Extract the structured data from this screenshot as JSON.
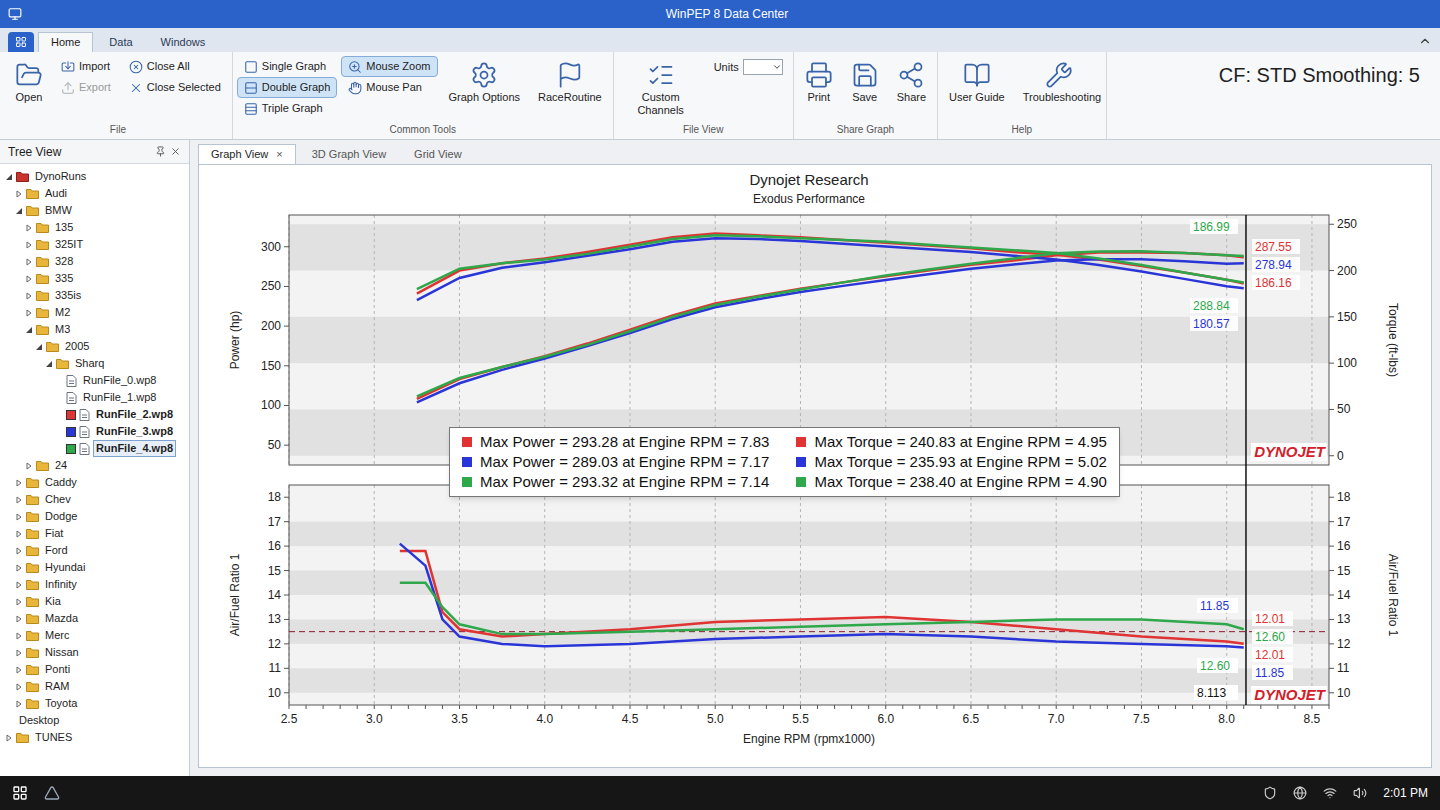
{
  "window": {
    "title": "WinPEP 8 Data Center"
  },
  "ribbon": {
    "tabs": [
      {
        "label": "Home",
        "selected": true
      },
      {
        "label": "Data",
        "selected": false
      },
      {
        "label": "Windows",
        "selected": false
      }
    ],
    "status": "CF: STD Smoothing: 5",
    "groups": [
      {
        "label": "File",
        "columns": [
          {
            "kind": "large",
            "items": [
              {
                "label": "Open",
                "selected": false,
                "disabled": false
              }
            ]
          },
          {
            "kind": "small",
            "items": [
              {
                "label": "Import",
                "selected": false,
                "disabled": false
              },
              {
                "label": "Export",
                "selected": false,
                "disabled": true
              }
            ]
          },
          {
            "kind": "small",
            "items": [
              {
                "label": "Close All",
                "selected": false,
                "disabled": false
              },
              {
                "label": "Close Selected",
                "selected": false,
                "disabled": false
              }
            ]
          }
        ]
      },
      {
        "label": "Common Tools",
        "columns": [
          {
            "kind": "small",
            "items": [
              {
                "label": "Single Graph",
                "selected": false,
                "disabled": false
              },
              {
                "label": "Double Graph",
                "selected": true,
                "disabled": false
              },
              {
                "label": "Triple Graph",
                "selected": false,
                "disabled": false
              }
            ]
          },
          {
            "kind": "small",
            "items": [
              {
                "label": "Mouse Zoom",
                "selected": true,
                "disabled": false
              },
              {
                "label": "Mouse Pan",
                "selected": false,
                "disabled": false
              }
            ]
          },
          {
            "kind": "large",
            "items": [
              {
                "label": "Graph Options",
                "selected": false,
                "disabled": false
              }
            ]
          },
          {
            "kind": "large",
            "items": [
              {
                "label": "RaceRoutine",
                "selected": false,
                "disabled": false
              }
            ]
          }
        ]
      },
      {
        "label": "File View",
        "columns": [
          {
            "kind": "large",
            "items": [
              {
                "label": "Custom Channels",
                "selected": false,
                "disabled": false
              }
            ]
          },
          {
            "kind": "dropdown",
            "items": [
              {
                "label": "Units",
                "selected": false,
                "disabled": false
              }
            ]
          }
        ]
      },
      {
        "label": "Share Graph",
        "columns": [
          {
            "kind": "large",
            "items": [
              {
                "label": "Print",
                "selected": false,
                "disabled": false
              }
            ]
          },
          {
            "kind": "large",
            "items": [
              {
                "label": "Save",
                "selected": false,
                "disabled": false
              }
            ]
          },
          {
            "kind": "large",
            "items": [
              {
                "label": "Share",
                "selected": false,
                "disabled": false
              }
            ]
          }
        ]
      },
      {
        "label": "Help",
        "columns": [
          {
            "kind": "large",
            "items": [
              {
                "label": "User Guide",
                "selected": false,
                "disabled": false
              }
            ]
          },
          {
            "kind": "large",
            "items": [
              {
                "label": "Troubleshooting",
                "selected": false,
                "disabled": false
              }
            ]
          }
        ]
      }
    ]
  },
  "tree": {
    "title": "Tree View",
    "items": [
      {
        "label": "DynoRuns",
        "depth": 0,
        "kind": "root",
        "expanded": true,
        "selected": false,
        "loaded": false
      },
      {
        "label": "Audi",
        "depth": 1,
        "kind": "folder",
        "expanded": false,
        "selected": false,
        "loaded": false
      },
      {
        "label": "BMW",
        "depth": 1,
        "kind": "folder",
        "expanded": true,
        "selected": false,
        "loaded": false
      },
      {
        "label": "135",
        "depth": 2,
        "kind": "folder",
        "expanded": false,
        "selected": false,
        "loaded": false
      },
      {
        "label": "325IT",
        "depth": 2,
        "kind": "folder",
        "expanded": false,
        "selected": false,
        "loaded": false
      },
      {
        "label": "328",
        "depth": 2,
        "kind": "folder",
        "expanded": false,
        "selected": false,
        "loaded": false
      },
      {
        "label": "335",
        "depth": 2,
        "kind": "folder",
        "expanded": false,
        "selected": false,
        "loaded": false
      },
      {
        "label": "335is",
        "depth": 2,
        "kind": "folder",
        "expanded": false,
        "selected": false,
        "loaded": false
      },
      {
        "label": "M2",
        "depth": 2,
        "kind": "folder",
        "expanded": false,
        "selected": false,
        "loaded": false
      },
      {
        "label": "M3",
        "depth": 2,
        "kind": "folder",
        "expanded": true,
        "selected": false,
        "loaded": false
      },
      {
        "label": "2005",
        "depth": 3,
        "kind": "folder",
        "expanded": true,
        "selected": false,
        "loaded": false
      },
      {
        "label": "Sharq",
        "depth": 4,
        "kind": "folder",
        "expanded": true,
        "selected": false,
        "loaded": false
      },
      {
        "label": "RunFile_0.wp8",
        "depth": 5,
        "kind": "file",
        "expanded": false,
        "selected": false,
        "loaded": false
      },
      {
        "label": "RunFile_1.wp8",
        "depth": 5,
        "kind": "file",
        "expanded": false,
        "selected": false,
        "loaded": false
      },
      {
        "label": "RunFile_2.wp8",
        "depth": 5,
        "kind": "file",
        "expanded": false,
        "selected": false,
        "loaded": true,
        "color": "#e03333"
      },
      {
        "label": "RunFile_3.wp8",
        "depth": 5,
        "kind": "file",
        "expanded": false,
        "selected": false,
        "loaded": true,
        "color": "#2a35d8"
      },
      {
        "label": "RunFile_4.wp8",
        "depth": 5,
        "kind": "file",
        "expanded": false,
        "selected": true,
        "loaded": true,
        "color": "#2ea84a"
      },
      {
        "label": "24",
        "depth": 2,
        "kind": "folder",
        "expanded": false,
        "selected": false,
        "loaded": false
      },
      {
        "label": "Caddy",
        "depth": 1,
        "kind": "folder",
        "expanded": false,
        "selected": false,
        "loaded": false
      },
      {
        "label": "Chev",
        "depth": 1,
        "kind": "folder",
        "expanded": false,
        "selected": false,
        "loaded": false
      },
      {
        "label": "Dodge",
        "depth": 1,
        "kind": "folder",
        "expanded": false,
        "selected": false,
        "loaded": false
      },
      {
        "label": "Fiat",
        "depth": 1,
        "kind": "folder",
        "expanded": false,
        "selected": false,
        "loaded": false
      },
      {
        "label": "Ford",
        "depth": 1,
        "kind": "folder",
        "expanded": false,
        "selected": false,
        "loaded": false
      },
      {
        "label": "Hyundai",
        "depth": 1,
        "kind": "folder",
        "expanded": false,
        "selected": false,
        "loaded": false
      },
      {
        "label": "Infinity",
        "depth": 1,
        "kind": "folder",
        "expanded": false,
        "selected": false,
        "loaded": false
      },
      {
        "label": "Kia",
        "depth": 1,
        "kind": "folder",
        "expanded": false,
        "selected": false,
        "loaded": false
      },
      {
        "label": "Mazda",
        "depth": 1,
        "kind": "folder",
        "expanded": false,
        "selected": false,
        "loaded": false
      },
      {
        "label": "Merc",
        "depth": 1,
        "kind": "folder",
        "expanded": false,
        "selected": false,
        "loaded": false
      },
      {
        "label": "Nissan",
        "depth": 1,
        "kind": "folder",
        "expanded": false,
        "selected": false,
        "loaded": false
      },
      {
        "label": "Ponti",
        "depth": 1,
        "kind": "folder",
        "expanded": false,
        "selected": false,
        "loaded": false
      },
      {
        "label": "RAM",
        "depth": 1,
        "kind": "folder",
        "expanded": false,
        "selected": false,
        "loaded": false
      },
      {
        "label": "Toyota",
        "depth": 1,
        "kind": "folder",
        "expanded": false,
        "selected": false,
        "loaded": false
      },
      {
        "label": "Desktop",
        "depth": 0,
        "kind": "location",
        "expanded": false,
        "selected": false,
        "loaded": false
      },
      {
        "label": "TUNES",
        "depth": 0,
        "kind": "folder",
        "expanded": false,
        "selected": false,
        "loaded": false
      }
    ]
  },
  "graph_tabs": [
    {
      "label": "Graph View",
      "selected": true,
      "close": "×"
    },
    {
      "label": "3D Graph View",
      "selected": false
    },
    {
      "label": "Grid View",
      "selected": false
    }
  ],
  "chart": {
    "title": "Dynojet Research",
    "subtitle": "Exodus Performance",
    "logo": "DYNOJET",
    "x_axis": {
      "label": "Engine RPM (rpmx1000)",
      "ticks": [
        "2.5",
        "3.0",
        "3.5",
        "4.0",
        "4.5",
        "5.0",
        "5.5",
        "6.0",
        "6.5",
        "7.0",
        "7.5",
        "8.0",
        "8.5"
      ]
    },
    "top": {
      "y_left": {
        "label": "Power (hp)",
        "ticks": [
          "50",
          "100",
          "150",
          "200",
          "250",
          "300"
        ]
      },
      "y_right": {
        "label": "Torque (ft-lbs)",
        "ticks": [
          "0",
          "50",
          "100",
          "150",
          "200",
          "250"
        ]
      },
      "rpm": [
        3.25,
        3.5,
        3.75,
        4.0,
        4.25,
        4.5,
        4.75,
        5.0,
        5.25,
        5.5,
        5.75,
        6.0,
        6.25,
        6.5,
        6.75,
        7.0,
        7.25,
        7.5,
        7.75,
        8.0,
        8.1
      ]
    },
    "bottom": {
      "y_left": {
        "label": "Air/Fuel Ratio 1",
        "ticks": [
          "10",
          "11",
          "12",
          "13",
          "14",
          "15",
          "16",
          "17",
          "18"
        ]
      },
      "y_right": {
        "label": "Air/Fuel Ratio 1",
        "ticks": [
          "10",
          "11",
          "12",
          "13",
          "14",
          "15",
          "16",
          "17",
          "18"
        ]
      },
      "rpm": [
        3.15,
        3.3,
        3.4,
        3.5,
        3.75,
        4.0,
        4.5,
        5.0,
        5.5,
        6.0,
        6.5,
        7.0,
        7.5,
        8.0,
        8.1
      ],
      "target": 12.5
    },
    "series": [
      {
        "color": "#e03333",
        "power": [
          108.3,
          133.3,
          148.5,
          162.2,
          178.0,
          195.4,
          213.4,
          228.5,
          237.9,
          247.1,
          255.1,
          262.8,
          270.1,
          277.2,
          282.7,
          289.2,
          292.7,
          292.7,
          292.2,
          289.4,
          286.9
        ],
        "torque": [
          175,
          200,
          208,
          213,
          220,
          228,
          236,
          240,
          238,
          236,
          233,
          230,
          227,
          224,
          220,
          217,
          212,
          205,
          198,
          190,
          186
        ],
        "afr": [
          15.8,
          15.8,
          13.3,
          12.6,
          12.3,
          12.4,
          12.6,
          12.9,
          13.0,
          13.1,
          12.9,
          12.6,
          12.3,
          12.1,
          12.01
        ]
      },
      {
        "color": "#2a35d8",
        "power": [
          104.0,
          128.0,
          144.9,
          159.2,
          174.8,
          191.1,
          208.9,
          223.7,
          233.9,
          243.0,
          250.7,
          258.2,
          265.4,
          272.3,
          277.6,
          282.6,
          284.4,
          284.2,
          281.8,
          278.7,
          279.1
        ],
        "torque": [
          168,
          192,
          203,
          209,
          216,
          223,
          231,
          235,
          234,
          232,
          229,
          226,
          223,
          220,
          216,
          212,
          206,
          199,
          191,
          183,
          181
        ],
        "afr": [
          16.1,
          15.2,
          13.0,
          12.3,
          12.0,
          11.9,
          12.0,
          12.2,
          12.3,
          12.4,
          12.3,
          12.1,
          12.0,
          11.9,
          11.85
        ]
      },
      {
        "color": "#2ea84a",
        "power": [
          111.4,
          134.6,
          148.5,
          161.5,
          176.4,
          193.6,
          211.6,
          226.6,
          236.9,
          246.1,
          255.1,
          263.9,
          271.3,
          278.5,
          285.3,
          291.9,
          294.0,
          294.2,
          292.2,
          289.4,
          288.4
        ],
        "torque": [
          180,
          202,
          208,
          212,
          218,
          226,
          234,
          238,
          237,
          235,
          233,
          231,
          228,
          225,
          222,
          219,
          213,
          206,
          198,
          190,
          187
        ],
        "afr": [
          14.5,
          14.5,
          13.5,
          12.8,
          12.4,
          12.4,
          12.5,
          12.6,
          12.7,
          12.8,
          12.9,
          13.0,
          13.0,
          12.8,
          12.6
        ]
      }
    ],
    "legend": [
      {
        "text": "Max Power = 293.28 at Engine RPM = 7.83",
        "color": "#e03333"
      },
      {
        "text": "Max Torque = 240.83 at Engine RPM = 4.95",
        "color": "#e03333"
      },
      {
        "text": "Max Power = 289.03 at Engine RPM = 7.17",
        "color": "#2a35d8"
      },
      {
        "text": "Max Torque = 235.93 at Engine RPM = 5.02",
        "color": "#2a35d8"
      },
      {
        "text": "Max Power = 293.32 at Engine RPM = 7.14",
        "color": "#2ea84a"
      },
      {
        "text": "Max Torque = 238.40 at Engine RPM = 4.90",
        "color": "#2ea84a"
      }
    ],
    "cursor": {
      "label": "8.113",
      "top_labels": [
        {
          "text": "186.99",
          "color": "#2ea84a",
          "side": "left"
        },
        {
          "text": "287.55",
          "color": "#e03333",
          "side": "right"
        },
        {
          "text": "278.94",
          "color": "#2a35d8",
          "side": "right"
        },
        {
          "text": "288.84",
          "color": "#2ea84a",
          "side": "left"
        },
        {
          "text": "186.16",
          "color": "#e03333",
          "side": "right"
        },
        {
          "text": "180.57",
          "color": "#2a35d8",
          "side": "left"
        }
      ],
      "bottom_labels": [
        {
          "text": "11.85",
          "color": "#2a35d8",
          "side": "left"
        },
        {
          "text": "12.01",
          "color": "#e03333",
          "side": "right"
        },
        {
          "text": "12.60",
          "color": "#2ea84a",
          "side": "left"
        },
        {
          "text": "12.60",
          "color": "#2ea84a",
          "side": "right"
        },
        {
          "text": "12.01",
          "color": "#e03333",
          "side": "right"
        },
        {
          "text": "11.85",
          "color": "#2a35d8",
          "side": "right"
        }
      ]
    }
  },
  "taskbar": {
    "time": "2:01 PM"
  }
}
